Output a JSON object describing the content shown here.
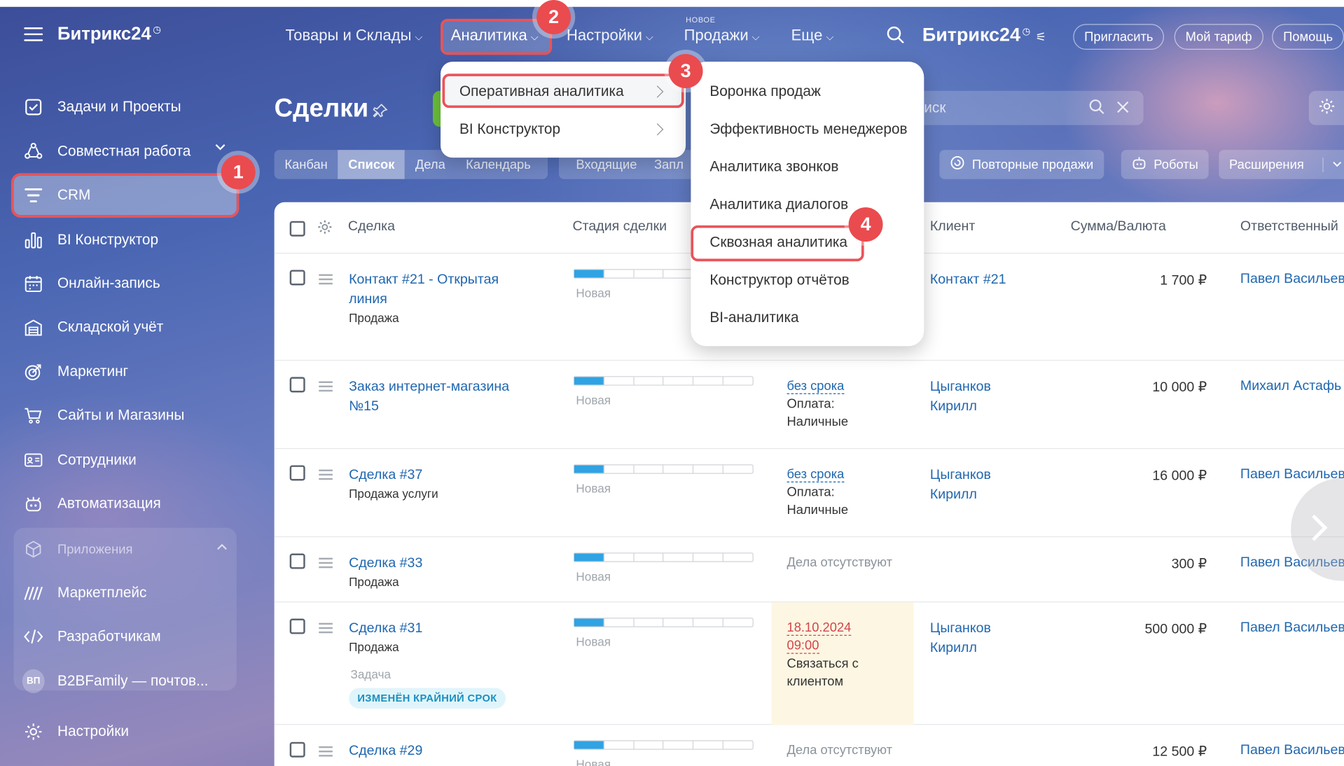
{
  "brand": {
    "name": "Битрикс24"
  },
  "topnav": {
    "items": [
      {
        "label": "Товары и Склады"
      },
      {
        "label": "Аналитика"
      },
      {
        "label": "Настройки"
      },
      {
        "label": "Продажи",
        "tag": "НОВОЕ"
      },
      {
        "label": "Еще"
      }
    ],
    "invite": "Пригласить",
    "tariff": "Мой тариф",
    "help": "Помощь"
  },
  "sidebar": {
    "items": [
      {
        "label": "Задачи и Проекты"
      },
      {
        "label": "Совместная работа"
      },
      {
        "label": "CRM"
      },
      {
        "label": "BI Конструктор"
      },
      {
        "label": "Онлайн-запись"
      },
      {
        "label": "Складской учёт"
      },
      {
        "label": "Маркетинг"
      },
      {
        "label": "Сайты и Магазины"
      },
      {
        "label": "Сотрудники"
      },
      {
        "label": "Автоматизация"
      }
    ],
    "apps": {
      "caption": "Приложения",
      "items": [
        {
          "label": "Маркетплейс"
        },
        {
          "label": "Разработчикам"
        },
        {
          "label": "B2BFamily — почтов...",
          "avatar": "ВП"
        }
      ]
    },
    "settings": "Настройки"
  },
  "page": {
    "title": "Сделки",
    "search_placeholder": "иск",
    "view_tabs": [
      "Канбан",
      "Список",
      "Дела",
      "Календарь"
    ],
    "counters": [
      "Входящие",
      "Запл"
    ],
    "repeat_sales": "Повторные продажи",
    "robots": "Роботы",
    "extensions": "Расширения"
  },
  "table": {
    "headers": [
      "Сделка",
      "Стадия сделки",
      "Клиент",
      "Сумма/Валюта",
      "Ответственный"
    ],
    "rows": [
      {
        "title": "Контакт #21 - Открытая линия",
        "sub": "Продажа",
        "stage": "Новая",
        "client": "Контакт #21",
        "sum": "1 700 ₽",
        "resp": "Павел Васильев"
      },
      {
        "title": "Заказ интернет-магазина №15",
        "sub": "",
        "stage": "Новая",
        "act_link": "без срока",
        "act_text": "Оплата: Наличные",
        "client": "Цыганков Кирилл",
        "sum": "10 000 ₽",
        "resp": "Михаил Астафь"
      },
      {
        "title": "Сделка #37",
        "sub": "Продажа услуги",
        "stage": "Новая",
        "act_link": "без срока",
        "act_text": "Оплата: Наличные",
        "client": "Цыганков Кирилл",
        "sum": "16 000 ₽",
        "resp": "Павел Васильев"
      },
      {
        "title": "Сделка #33",
        "sub": "Продажа",
        "stage": "Новая",
        "act_none": "Дела отсутствуют",
        "client": "",
        "sum": "300 ₽",
        "resp": "Павел Васильев"
      },
      {
        "title": "Сделка #31",
        "sub": "Продажа",
        "stage": "Новая",
        "act_date": "18.10.2024",
        "act_time": "09:00",
        "act_text": "Связаться с клиентом",
        "task_caption": "Задача",
        "badge": "ИЗМЕНЁН КРАЙНИЙ СРОК",
        "client": "Цыганков Кирилл",
        "sum": "500 000 ₽",
        "resp": "Павел Васильев"
      },
      {
        "title": "Сделка #29",
        "sub": "",
        "stage": "Новая",
        "act_none": "Дела отсутствуют",
        "client": "",
        "sum": "12 500 ₽",
        "resp": "Павел Васильев"
      }
    ]
  },
  "analytics_menu": {
    "items": [
      {
        "label": "Оперативная аналитика"
      },
      {
        "label": "BI Конструктор"
      }
    ],
    "submenu": [
      "Воронка продаж",
      "Эффективность менеджеров",
      "Аналитика звонков",
      "Аналитика диалогов",
      "Сквозная аналитика",
      "Конструктор отчётов",
      "BI-аналитика"
    ]
  },
  "steps": [
    "1",
    "2",
    "3",
    "4"
  ],
  "colors": {
    "highlight": "#e8545a",
    "link": "#2067b0",
    "stage_on": "#2fa3e4",
    "badge_bg": "#e0f5fb"
  }
}
